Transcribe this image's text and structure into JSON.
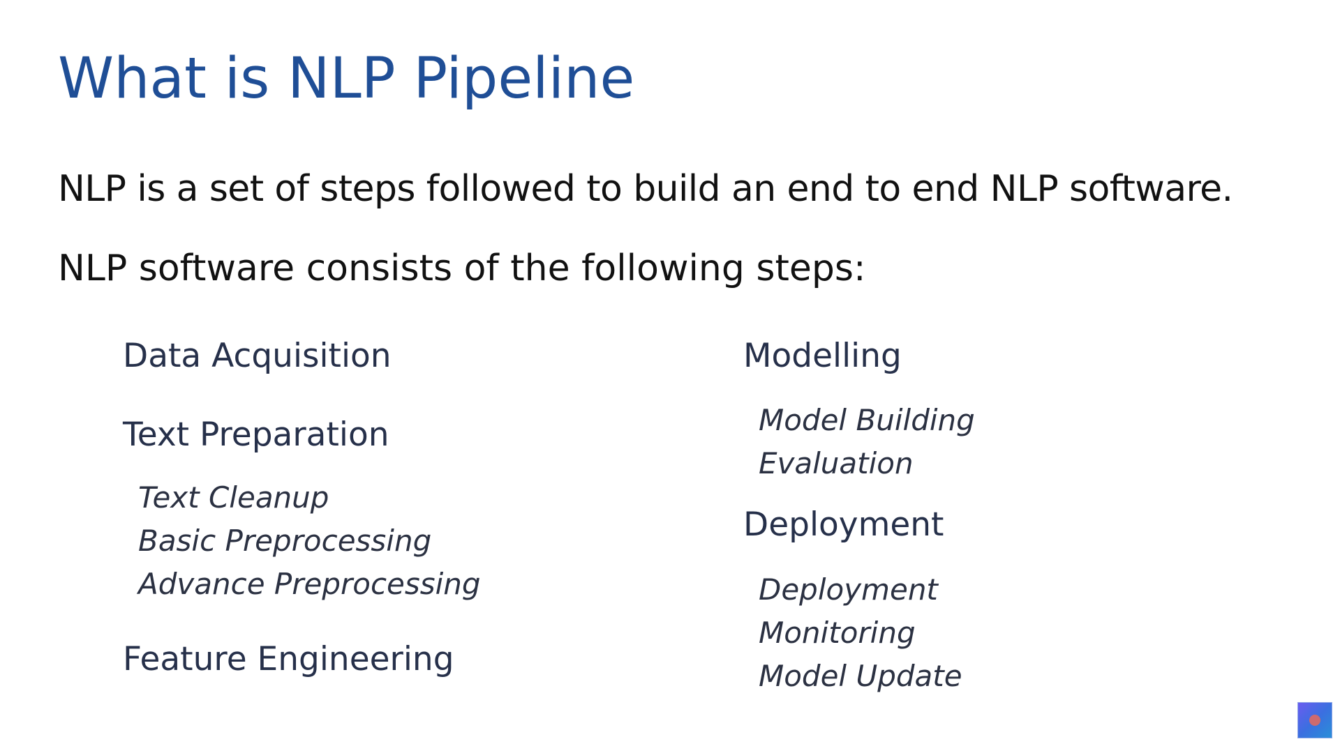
{
  "slide": {
    "title": "What is NLP Pipeline",
    "paragraphs": [
      "NLP is a set of steps followed to build an end to end NLP software.",
      "NLP software consists of the following steps:"
    ],
    "left_column": {
      "data_acquisition": "Data Acquisition",
      "text_preparation": {
        "label": "Text Preparation",
        "items": [
          "Text Cleanup",
          "Basic Preprocessing",
          "Advance Preprocessing"
        ]
      },
      "feature_engineering": "Feature Engineering"
    },
    "right_column": {
      "modelling": {
        "label": "Modelling",
        "items": [
          "Model Building",
          "Evaluation"
        ]
      },
      "deployment": {
        "label": "Deployment",
        "items": [
          "Deployment",
          "Monitoring",
          "Model Update"
        ]
      }
    }
  }
}
